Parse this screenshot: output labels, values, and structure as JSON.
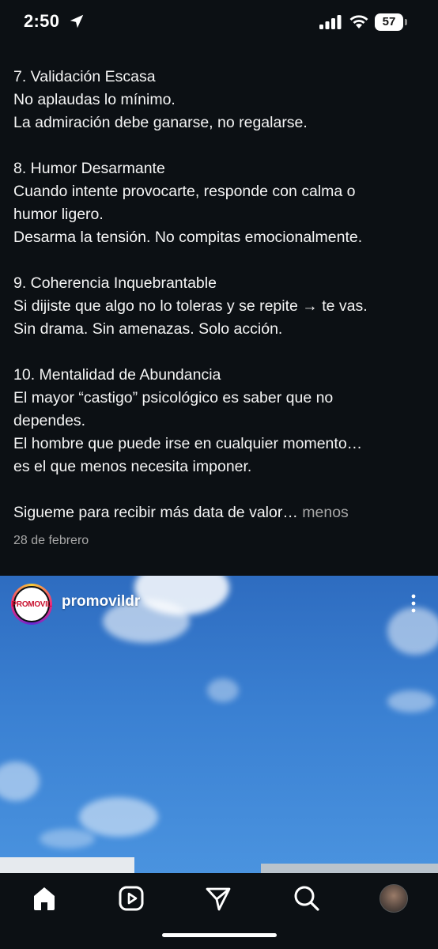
{
  "status_bar": {
    "time": "2:50",
    "battery": "57"
  },
  "caption": {
    "lines": [
      "7. Validación Escasa",
      "No aplaudas lo mínimo.",
      "La admiración debe ganarse, no regalarse.",
      "",
      "8. Humor Desarmante",
      "Cuando intente provocarte, responde con calma o",
      "humor ligero.",
      "Desarma la tensión. No compitas emocionalmente.",
      "",
      "9. Coherencia Inquebrantable",
      "Si dijiste que algo no lo toleras y se repite → te vas.",
      "Sin drama. Sin amenazas. Solo acción.",
      "",
      "10. Mentalidad de Abundancia",
      "El mayor “castigo” psicológico es saber que no",
      "dependes.",
      "El hombre que puede irse en cualquier momento…",
      "es el que menos necesita imponer.",
      ""
    ],
    "last_line": "Sigueme para recibir más data de valor… ",
    "more_label": "menos",
    "date": "28 de febrero"
  },
  "next_post": {
    "username": "promovildr",
    "avatar_logo": "PROMOVIL"
  },
  "colors": {
    "background": "#0c1014",
    "text": "#f5f5f5",
    "muted": "#a8a8a8"
  },
  "icons": {
    "nav": [
      "home-icon",
      "reels-icon",
      "direct-message-icon",
      "search-icon",
      "profile-avatar"
    ],
    "status": [
      "location-arrow-icon",
      "cellular-signal-icon",
      "wifi-icon",
      "battery-icon"
    ]
  }
}
